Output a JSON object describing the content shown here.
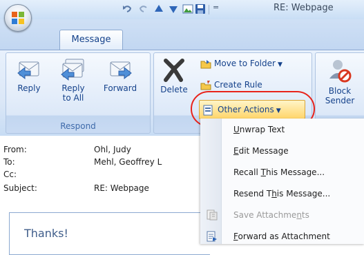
{
  "window": {
    "title": "RE: Webpage"
  },
  "quick_access": {
    "more_glyph": "="
  },
  "tabs": [
    {
      "label": "Message"
    }
  ],
  "ribbon": {
    "respond": {
      "label": "Respond",
      "reply": "Reply",
      "reply_all_line1": "Reply",
      "reply_all_line2": "to All",
      "forward": "Forward"
    },
    "actions": {
      "delete": "Delete",
      "move_to_folder": "Move to Folder",
      "create_rule": "Create Rule",
      "other_actions": "Other Actions"
    },
    "junk": {
      "block_line1": "Block",
      "block_line2": "Sender"
    }
  },
  "message": {
    "from_label": "From:",
    "from_value": "Ohl, Judy",
    "to_label": "To:",
    "to_value": "Mehl, Geoffrey L",
    "cc_label": "Cc:",
    "cc_value": "",
    "subject_label": "Subject:",
    "subject_value": "RE: Webpage",
    "body_text": "Thanks!"
  },
  "other_actions_menu": [
    {
      "pre": "",
      "key": "U",
      "post": "nwrap Text",
      "enabled": true
    },
    {
      "pre": "",
      "key": "E",
      "post": "dit Message",
      "enabled": true
    },
    {
      "pre": "Recall ",
      "key": "T",
      "post": "his Message...",
      "enabled": true
    },
    {
      "pre": "Resend T",
      "key": "h",
      "post": "is Message...",
      "enabled": true
    },
    {
      "pre": "Save Attachme",
      "key": "n",
      "post": "ts",
      "enabled": false
    },
    {
      "pre": "",
      "key": "F",
      "post": "orward as Attachment",
      "enabled": true
    }
  ]
}
